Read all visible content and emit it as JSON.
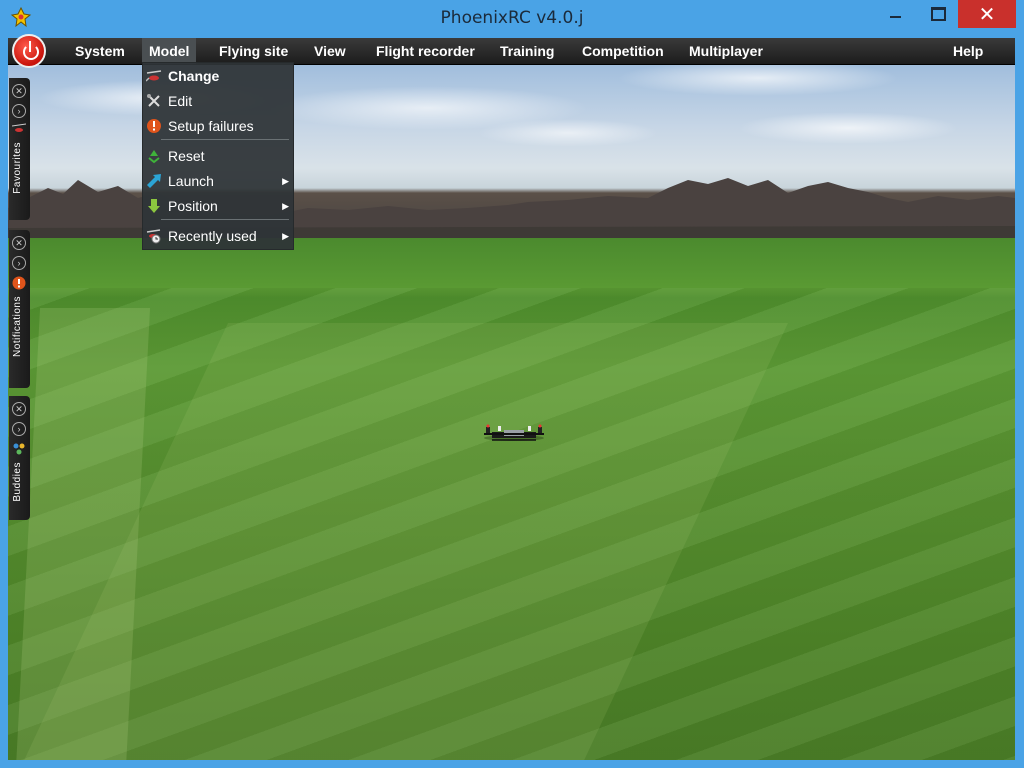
{
  "window": {
    "title": "PhoenixRC v4.0.j"
  },
  "menubar": {
    "items": [
      {
        "label": "System"
      },
      {
        "label": "Model"
      },
      {
        "label": "Flying site"
      },
      {
        "label": "View"
      },
      {
        "label": "Flight recorder"
      },
      {
        "label": "Training"
      },
      {
        "label": "Competition"
      },
      {
        "label": "Multiplayer"
      },
      {
        "label": "Help"
      }
    ]
  },
  "model_menu": {
    "items": [
      {
        "label": "Change",
        "icon": "helicopter-icon"
      },
      {
        "label": "Edit",
        "icon": "tools-icon"
      },
      {
        "label": "Setup failures",
        "icon": "warning-icon"
      },
      {
        "label": "Reset",
        "icon": "recycle-icon"
      },
      {
        "label": "Launch",
        "icon": "launch-arrow-icon"
      },
      {
        "label": "Position",
        "icon": "down-arrow-icon"
      },
      {
        "label": "Recently used",
        "icon": "clock-heli-icon"
      }
    ]
  },
  "side_tabs": {
    "favourites": "Favourites",
    "notifications": "Notifications",
    "buddies": "Buddies"
  },
  "colors": {
    "title_bar": "#4aa3e6",
    "close_button": "#c9302c",
    "menubar": "#1c1c1c",
    "dropdown_bg": "#2f3437"
  }
}
